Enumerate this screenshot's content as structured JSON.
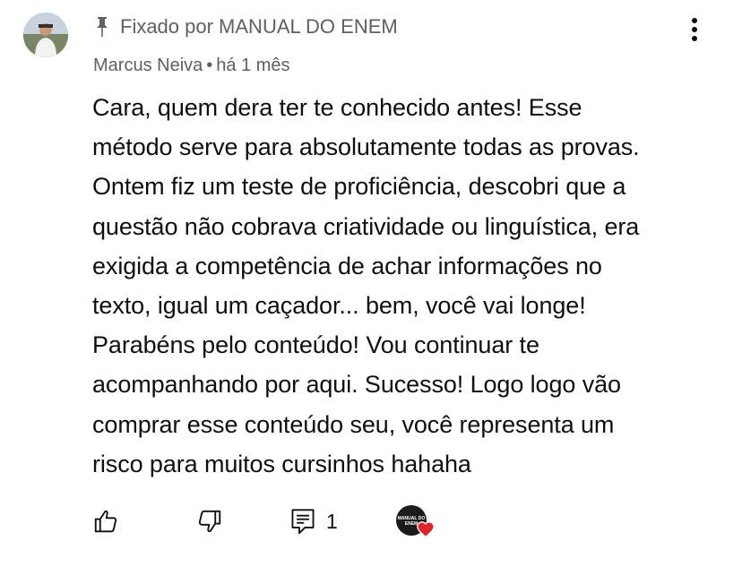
{
  "comment": {
    "pinned_label": "Fixado por MANUAL DO ENEM",
    "author": "Marcus Neiva",
    "separator": "•",
    "time": "há 1 mês",
    "text_lines": [
      "Cara, quem dera ter te conhecido antes! Esse",
      "método serve para absolutamente todas as provas.",
      "Ontem fiz um teste de proficiência, descobri que a",
      "questão não cobrava criatividade ou linguística, era",
      "exigida a competência de achar informações no",
      "texto, igual um caçador... bem, você vai longe!",
      "Parabéns pelo conteúdo! Vou continuar te",
      "acompanhando por aqui. Sucesso! Logo logo vão",
      "comprar esse conteúdo seu, você representa um",
      "risco para muitos cursinhos hahaha"
    ]
  },
  "actions": {
    "reply_count": "1",
    "creator_logo_text": "MANUAL DO ENEM"
  },
  "icons": {
    "pin": "pin-icon",
    "more": "more-vert-icon",
    "like": "thumb-up-icon",
    "dislike": "thumb-down-icon",
    "replies": "comment-replies-icon",
    "heart": "heart-icon"
  },
  "colors": {
    "text": "#0f0f0f",
    "secondary_text": "#606060",
    "heart": "#e0242a",
    "background": "#ffffff"
  }
}
